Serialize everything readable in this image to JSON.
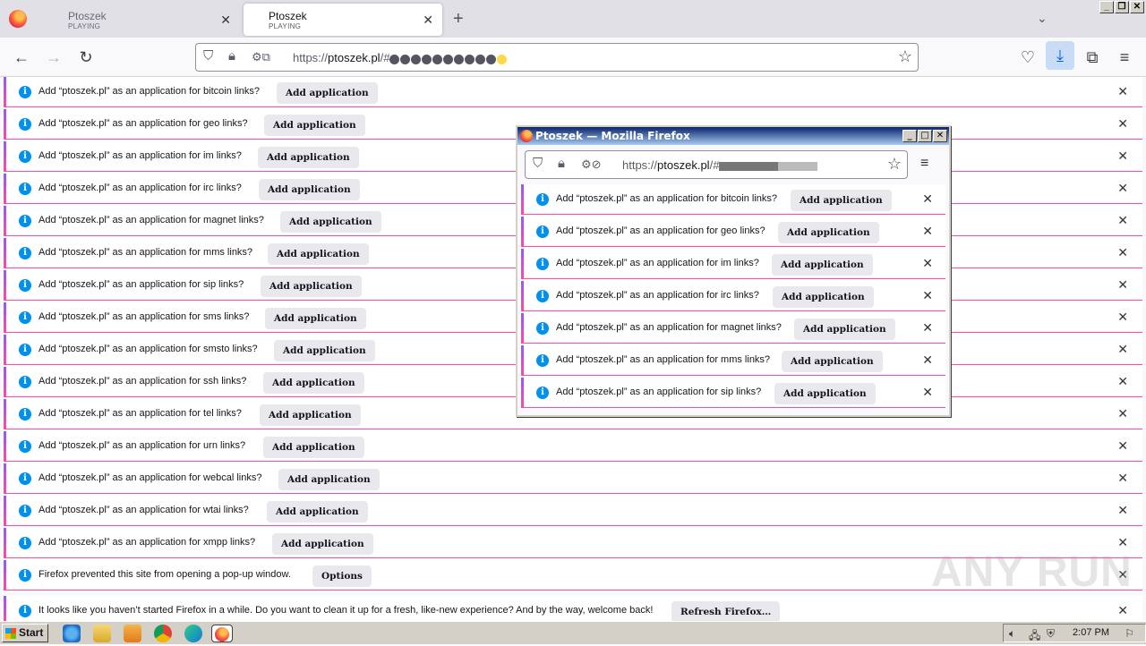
{
  "tabs": [
    {
      "title": "Ptoszek",
      "subtitle": "PLAYING",
      "active": false
    },
    {
      "title": "Ptoszek",
      "subtitle": "PLAYING",
      "active": true
    }
  ],
  "url": {
    "scheme": "https://",
    "host": "ptoszek.pl",
    "path": "/#"
  },
  "notifications": [
    {
      "text": "Add “ptoszek.pl” as an application for bitcoin links?",
      "button": "Add application"
    },
    {
      "text": "Add “ptoszek.pl” as an application for geo links?",
      "button": "Add application"
    },
    {
      "text": "Add “ptoszek.pl” as an application for im links?",
      "button": "Add application"
    },
    {
      "text": "Add “ptoszek.pl” as an application for irc links?",
      "button": "Add application"
    },
    {
      "text": "Add “ptoszek.pl” as an application for magnet links?",
      "button": "Add application"
    },
    {
      "text": "Add “ptoszek.pl” as an application for mms links?",
      "button": "Add application"
    },
    {
      "text": "Add “ptoszek.pl” as an application for sip links?",
      "button": "Add application"
    },
    {
      "text": "Add “ptoszek.pl” as an application for sms links?",
      "button": "Add application"
    },
    {
      "text": "Add “ptoszek.pl” as an application for smsto links?",
      "button": "Add application"
    },
    {
      "text": "Add “ptoszek.pl” as an application for ssh links?",
      "button": "Add application"
    },
    {
      "text": "Add “ptoszek.pl” as an application for tel links?",
      "button": "Add application"
    },
    {
      "text": "Add “ptoszek.pl” as an application for urn links?",
      "button": "Add application"
    },
    {
      "text": "Add “ptoszek.pl” as an application for webcal links?",
      "button": "Add application"
    },
    {
      "text": "Add “ptoszek.pl” as an application for wtai links?",
      "button": "Add application"
    },
    {
      "text": "Add “ptoszek.pl” as an application for xmpp links?",
      "button": "Add application"
    },
    {
      "text": "Firefox prevented this site from opening a pop-up window.",
      "button": "Options"
    },
    {
      "text": "It looks like you haven’t started Firefox in a while. Do you want to clean it up for a fresh, like-new experience? And by the way, welcome back!",
      "button": "Refresh Firefox…"
    }
  ],
  "popup": {
    "title": "Ptoszek — Mozilla Firefox",
    "url": {
      "scheme": "https://",
      "host": "ptoszek.pl",
      "path": "/#"
    },
    "notifications": [
      {
        "text": "Add “ptoszek.pl” as an application for bitcoin links?",
        "button": "Add application"
      },
      {
        "text": "Add “ptoszek.pl” as an application for geo links?",
        "button": "Add application"
      },
      {
        "text": "Add “ptoszek.pl” as an application for im links?",
        "button": "Add application"
      },
      {
        "text": "Add “ptoszek.pl” as an application for irc links?",
        "button": "Add application"
      },
      {
        "text": "Add “ptoszek.pl” as an application for magnet links?",
        "button": "Add application"
      },
      {
        "text": "Add “ptoszek.pl” as an application for mms links?",
        "button": "Add application"
      },
      {
        "text": "Add “ptoszek.pl” as an application for sip links?",
        "button": "Add application"
      }
    ]
  },
  "taskbar": {
    "start": "Start",
    "clock": "2:07 PM"
  },
  "watermark": "ANY RUN",
  "colors": {
    "accent": "#0090ed",
    "bar_gradient_top": "#9059ff",
    "bar_gradient_bottom": "#ff4aa2"
  }
}
